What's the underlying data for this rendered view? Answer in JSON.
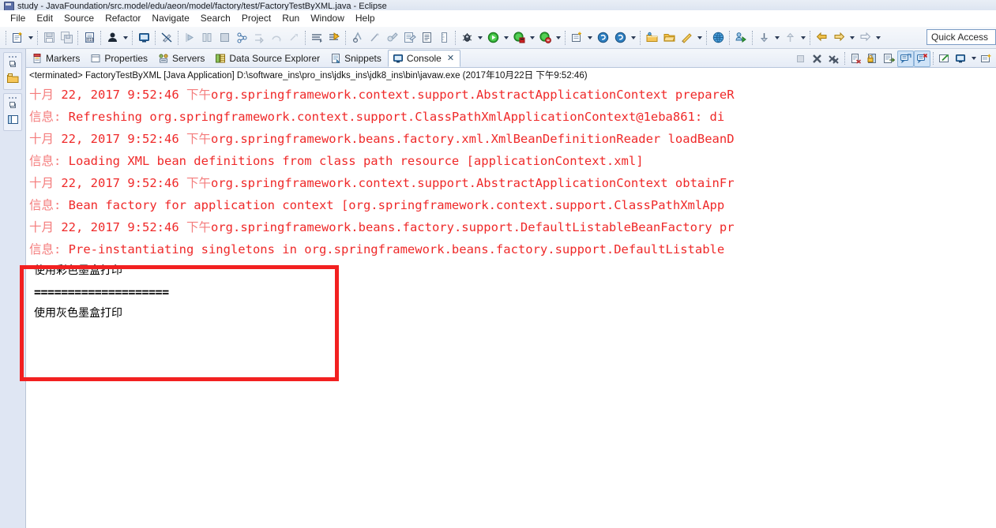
{
  "window": {
    "title": "study - JavaFoundation/src.model/edu/aeon/model/factory/test/FactoryTestByXML.java - Eclipse",
    "app_icon": "eclipse-icon"
  },
  "menubar": {
    "items": [
      {
        "label": "File"
      },
      {
        "label": "Edit"
      },
      {
        "label": "Source"
      },
      {
        "label": "Refactor"
      },
      {
        "label": "Navigate"
      },
      {
        "label": "Search"
      },
      {
        "label": "Project"
      },
      {
        "label": "Run"
      },
      {
        "label": "Window"
      },
      {
        "label": "Help"
      }
    ]
  },
  "toolbar": {
    "quick_access_placeholder": "Quick Access",
    "buttons": [
      {
        "name": "new-wizard-icon"
      },
      {
        "name": "save-icon"
      },
      {
        "name": "save-all-icon"
      },
      {
        "name": "new-java-class-icon"
      },
      {
        "name": "user-profile-icon"
      },
      {
        "name": "open-console-icon"
      },
      {
        "name": "toggle-mark-occurrences-icon"
      },
      {
        "name": "step-into-icon"
      },
      {
        "name": "toggle-breakpoint-icon"
      },
      {
        "name": "terminate-icon"
      },
      {
        "name": "skip-breakpoints-icon"
      },
      {
        "name": "step-return-icon"
      },
      {
        "name": "step-over-icon"
      },
      {
        "name": "resume-icon"
      },
      {
        "name": "open-task-icon"
      },
      {
        "name": "annotate-icon"
      },
      {
        "name": "search-icon"
      },
      {
        "name": "run-last-tool-icon"
      },
      {
        "name": "external-tools-icon"
      },
      {
        "name": "build-all-icon"
      },
      {
        "name": "outline-icon"
      },
      {
        "name": "toggle-ruler-icon"
      },
      {
        "name": "debug-icon"
      },
      {
        "name": "run-icon"
      },
      {
        "name": "run-as-server-icon"
      },
      {
        "name": "profile-icon"
      },
      {
        "name": "new-project-icon"
      },
      {
        "name": "spring-tool-icon"
      },
      {
        "name": "spring-boot-icon"
      },
      {
        "name": "open-type-icon"
      },
      {
        "name": "open-resource-icon"
      },
      {
        "name": "quick-fix-icon"
      },
      {
        "name": "open-web-browser-icon"
      },
      {
        "name": "team-sync-icon"
      },
      {
        "name": "previous-annotation-icon"
      },
      {
        "name": "next-annotation-icon"
      },
      {
        "name": "back-icon"
      },
      {
        "name": "forward-icon"
      }
    ]
  },
  "leftbar": {
    "items": [
      {
        "name": "fast-view-package-explorer",
        "icon": "folder-icon"
      },
      {
        "name": "fast-view-outline",
        "icon": "outline-panel-icon"
      }
    ]
  },
  "view_tabs": [
    {
      "label": "Markers",
      "icon": "markers-icon",
      "active": false
    },
    {
      "label": "Properties",
      "icon": "properties-icon",
      "active": false
    },
    {
      "label": "Servers",
      "icon": "servers-icon",
      "active": false
    },
    {
      "label": "Data Source Explorer",
      "icon": "data-source-explorer-icon",
      "active": false
    },
    {
      "label": "Snippets",
      "icon": "snippets-icon",
      "active": false
    },
    {
      "label": "Console",
      "icon": "console-icon",
      "active": true,
      "close": "✕"
    }
  ],
  "console_toolbar": {
    "buttons": [
      {
        "name": "terminate-button",
        "state": "disabled"
      },
      {
        "name": "remove-launch-button",
        "state": "enabled"
      },
      {
        "name": "remove-all-terminated-button",
        "state": "enabled"
      },
      {
        "name": "clear-console-button",
        "state": "enabled"
      },
      {
        "name": "scroll-lock-button",
        "state": "enabled"
      },
      {
        "name": "word-wrap-button",
        "state": "enabled"
      },
      {
        "name": "show-console-on-output-button",
        "state": "selected"
      },
      {
        "name": "show-console-on-error-button",
        "state": "selected"
      },
      {
        "name": "pin-console-button",
        "state": "enabled"
      },
      {
        "name": "display-selected-console-button",
        "state": "enabled"
      },
      {
        "name": "open-console-button",
        "state": "enabled"
      }
    ]
  },
  "console": {
    "status_line": "<terminated> FactoryTestByXML [Java Application] D:\\software_ins\\pro_ins\\jdks_ins\\jdk8_ins\\bin\\javaw.exe (2017年10月22日 下午9:52:46)",
    "lines": [
      {
        "stream": "err",
        "prefix_cjk": "十月 ",
        "text": "22, 2017 9:52:46 ",
        "mid_cjk": "下午",
        "tail": "org.springframework.context.support.AbstractApplicationContext prepareR"
      },
      {
        "stream": "err",
        "prefix_cjk": "信息: ",
        "text": "Refreshing org.springframework.context.support.ClassPathXmlApplicationContext@1eba861: di",
        "mid_cjk": "",
        "tail": ""
      },
      {
        "stream": "err",
        "prefix_cjk": "十月 ",
        "text": "22, 2017 9:52:46 ",
        "mid_cjk": "下午",
        "tail": "org.springframework.beans.factory.xml.XmlBeanDefinitionReader loadBeanD"
      },
      {
        "stream": "err",
        "prefix_cjk": "信息: ",
        "text": "Loading XML bean definitions from class path resource [applicationContext.xml]",
        "mid_cjk": "",
        "tail": ""
      },
      {
        "stream": "err",
        "prefix_cjk": "十月 ",
        "text": "22, 2017 9:52:46 ",
        "mid_cjk": "下午",
        "tail": "org.springframework.context.support.AbstractApplicationContext obtainFr"
      },
      {
        "stream": "err",
        "prefix_cjk": "信息: ",
        "text": "Bean factory for application context [org.springframework.context.support.ClassPathXmlApp",
        "mid_cjk": "",
        "tail": ""
      },
      {
        "stream": "err",
        "prefix_cjk": "十月 ",
        "text": "22, 2017 9:52:46 ",
        "mid_cjk": "下午",
        "tail": "org.springframework.beans.factory.support.DefaultListableBeanFactory pr"
      },
      {
        "stream": "err",
        "prefix_cjk": "信息: ",
        "text": "Pre-instantiating singletons in org.springframework.beans.factory.support.DefaultListable",
        "mid_cjk": "",
        "tail": ""
      }
    ],
    "output_lines": [
      {
        "stream": "out",
        "text": "使用彩色墨盒打印",
        "style": "cjk"
      },
      {
        "stream": "out",
        "text": "====================",
        "style": "eq"
      },
      {
        "stream": "out",
        "text": "使用灰色墨盒打印",
        "style": "cjk"
      }
    ]
  },
  "annotation": {
    "name": "red-highlight-rectangle",
    "color": "#f22020"
  },
  "colors": {
    "error_text": "#ef2929",
    "output_text": "#000000",
    "toolbar_bg": "#eaeff7",
    "tab_active_bg": "#ffffff",
    "annotation": "#f22020"
  }
}
